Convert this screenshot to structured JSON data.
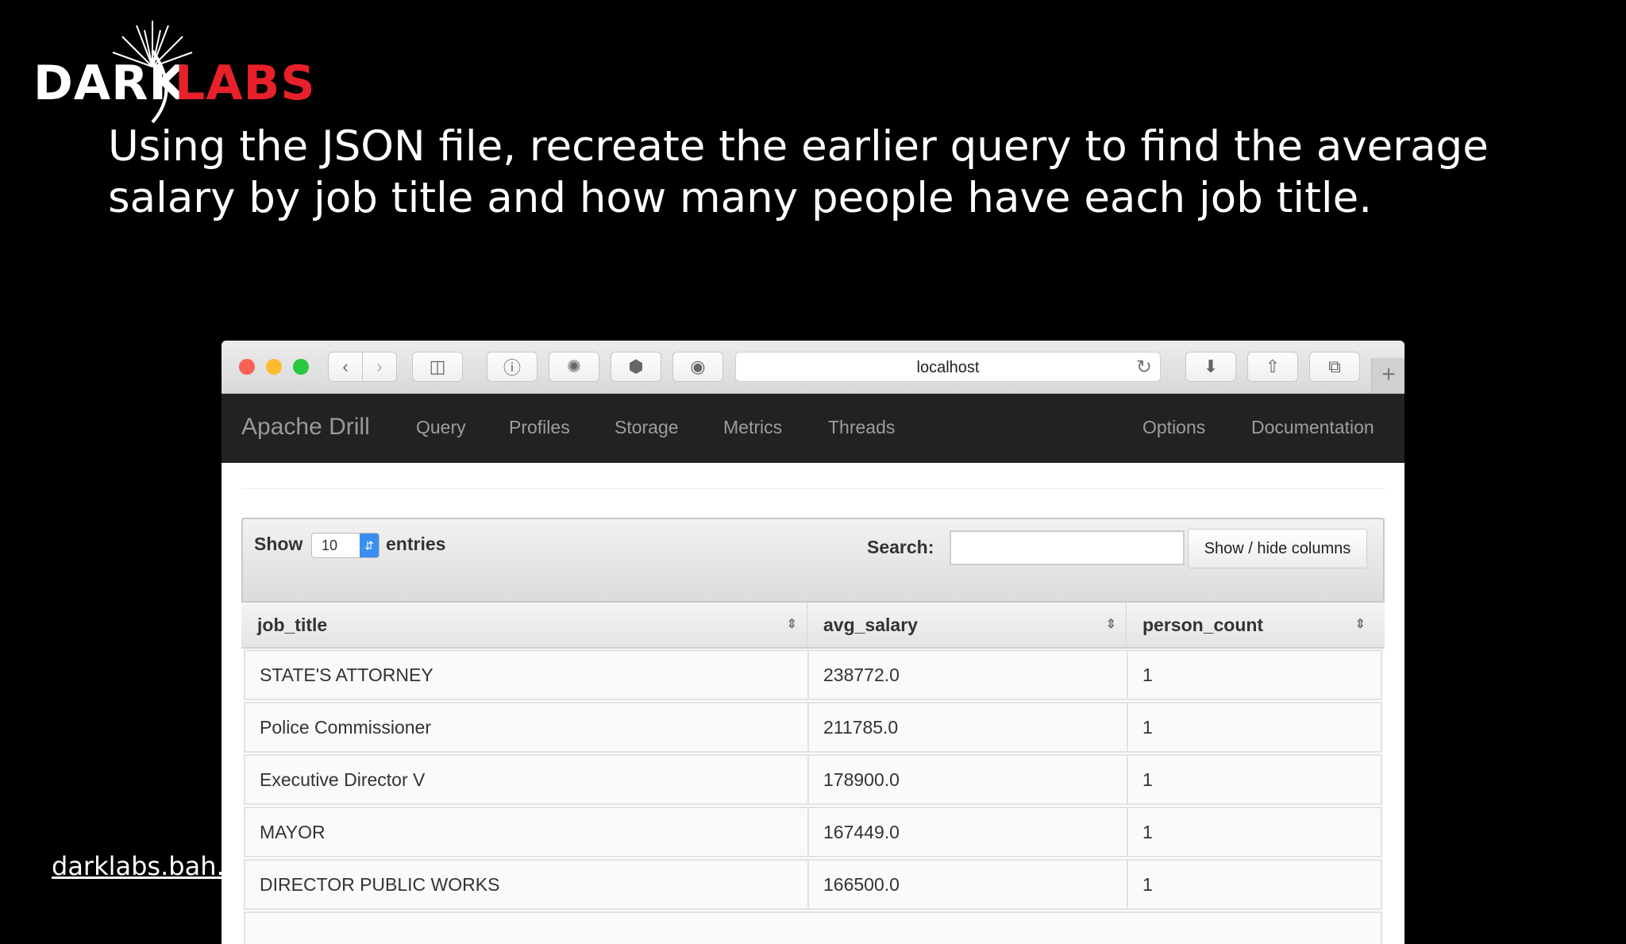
{
  "logo": {
    "word1": "DARK",
    "word2": "LABS"
  },
  "headline": {
    "line1": "Using the JSON file, recreate the earlier query to find the average",
    "line2": "salary by job title and how many people have each job title."
  },
  "footer": {
    "link": "darklabs.bah.c"
  },
  "browser": {
    "url": "localhost",
    "toolbar_icons": [
      "back-icon",
      "forward-icon",
      "sidebar-icon",
      "info-icon",
      "extension-icon",
      "shield-icon",
      "record-icon",
      "download-icon",
      "share-icon",
      "tabs-icon",
      "new-tab-icon",
      "reload-icon"
    ]
  },
  "navbar": {
    "brand": "Apache Drill",
    "left_links": [
      "Query",
      "Profiles",
      "Storage",
      "Metrics",
      "Threads"
    ],
    "right_links": [
      "Options",
      "Documentation"
    ]
  },
  "controls": {
    "show_label": "Show",
    "page_length": "10",
    "entries_label": "entries",
    "search_label": "Search:",
    "search_value": "",
    "colvis_label": "Show / hide columns"
  },
  "table": {
    "columns": [
      "job_title",
      "avg_salary",
      "person_count"
    ],
    "rows": [
      [
        "STATE'S ATTORNEY",
        "238772.0",
        "1"
      ],
      [
        "Police Commissioner",
        "211785.0",
        "1"
      ],
      [
        "Executive Director V",
        "178900.0",
        "1"
      ],
      [
        "MAYOR",
        "167449.0",
        "1"
      ],
      [
        "DIRECTOR PUBLIC WORKS",
        "166500.0",
        "1"
      ]
    ]
  },
  "colors": {
    "logo_red": "#e8202a",
    "navbar_bg": "#222222",
    "select_blue": "#3a8ef0"
  }
}
